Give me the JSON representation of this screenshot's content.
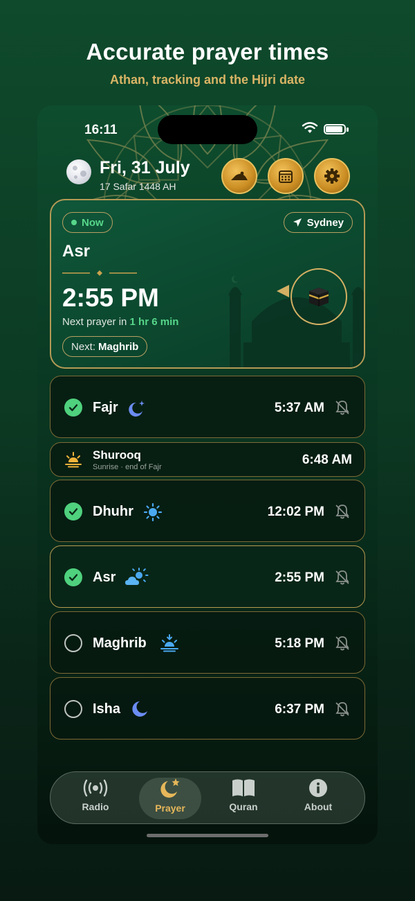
{
  "marketing": {
    "headline": "Accurate prayer times",
    "subheadline": "Athan, tracking and the Hijri date"
  },
  "status_bar": {
    "time": "16:11"
  },
  "header": {
    "date": "Fri, 31 July",
    "hijri_date": "17 Safar 1448 AH",
    "buttons": [
      "prayer-mat-icon",
      "calendar-icon",
      "settings-icon"
    ]
  },
  "current": {
    "status": "Now",
    "location": "Sydney",
    "prayer": "Asr",
    "time": "2:55 PM",
    "next_prefix": "Next prayer in",
    "countdown": "1 hr 6 min",
    "next_label": "Next:",
    "next_prayer": "Maghrib"
  },
  "prayers": [
    {
      "name": "Fajr",
      "time": "5:37 AM",
      "done": true,
      "icon": "moon-stars-icon"
    },
    {
      "name": "Shurooq",
      "subtitle": "Sunrise · end of Fajr",
      "time": "6:48 AM",
      "icon": "sunrise-icon"
    },
    {
      "name": "Dhuhr",
      "time": "12:02 PM",
      "done": true,
      "icon": "sun-icon"
    },
    {
      "name": "Asr",
      "time": "2:55 PM",
      "done": true,
      "icon": "cloud-sun-icon",
      "active": true
    },
    {
      "name": "Maghrib",
      "time": "5:18 PM",
      "done": false,
      "icon": "sunset-icon"
    },
    {
      "name": "Isha",
      "time": "6:37 PM",
      "done": false,
      "icon": "crescent-moon-icon"
    }
  ],
  "tabs": [
    {
      "label": "Radio",
      "icon": "radio-icon"
    },
    {
      "label": "Prayer",
      "icon": "crescent-star-icon",
      "selected": true
    },
    {
      "label": "Quran",
      "icon": "book-icon"
    },
    {
      "label": "About",
      "icon": "info-icon"
    }
  ],
  "colors": {
    "accent_gold": "#d9b465",
    "status_green": "#57d68a",
    "background": "#0c3a23"
  }
}
